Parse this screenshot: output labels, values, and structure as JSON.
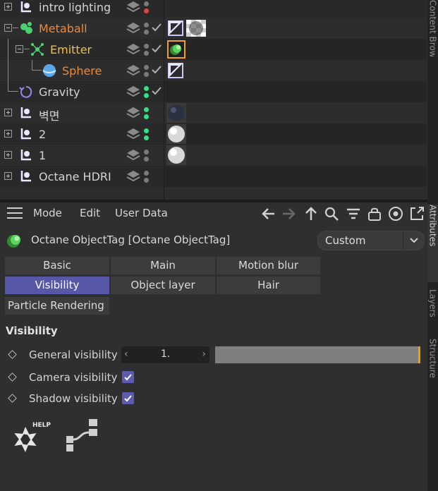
{
  "objects": [
    {
      "name": "intro lighting",
      "color": "normal"
    },
    {
      "name": "Metaball",
      "color": "orange"
    },
    {
      "name": "Emitter",
      "color": "yellow"
    },
    {
      "name": "Sphere",
      "color": "orange"
    },
    {
      "name": "Gravity",
      "color": "normal"
    },
    {
      "name": "벽면",
      "color": "normal"
    },
    {
      "name": "2",
      "color": "normal"
    },
    {
      "name": "1",
      "color": "normal"
    },
    {
      "name": "Octane HDRI",
      "color": "normal"
    }
  ],
  "side_tabs": {
    "top": "Content Browser",
    "attributes": "Attributes",
    "layers": "Layers",
    "structure": "Structure"
  },
  "menu": {
    "mode": "Mode",
    "edit": "Edit",
    "user_data": "User Data"
  },
  "tag_header": {
    "title": "Octane ObjectTag [Octane ObjectTag]",
    "mode_value": "Custom"
  },
  "tabs": {
    "row1": [
      "Basic",
      "Main",
      "Motion blur"
    ],
    "row2": [
      "Visibility",
      "Object layer",
      "Hair"
    ],
    "row3": [
      "Particle Rendering"
    ],
    "active": "Visibility"
  },
  "visibility": {
    "section_title": "Visibility",
    "general_label": "General visibility",
    "general_value": "1.",
    "general_fraction": 1.0,
    "camera_label": "Camera visibility",
    "camera_checked": true,
    "shadow_label": "Shadow visibility",
    "shadow_checked": true
  },
  "colors": {
    "accent": "#5757a8",
    "orange_name": "#e88a42",
    "yellow_name": "#f2c038",
    "green_dot": "#3ddc84",
    "red_dot": "#e04444",
    "slider_end": "#f0a000"
  },
  "icons": {
    "help_badge": "HELP"
  }
}
